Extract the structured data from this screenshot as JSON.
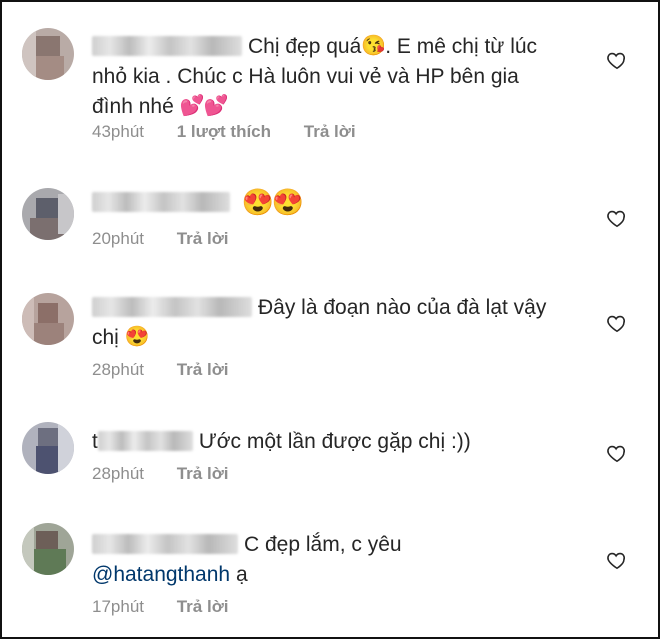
{
  "comments": [
    {
      "initial": "",
      "text_part1": "Chị đẹp quá",
      "emoji1": "kissing-face-emoji",
      "text_part2": ". E mê chị từ lúc nhỏ kia . Chúc c Hà luôn vui vẻ và HP bên gia đình nhé",
      "emoji2": "two-hearts-emoji",
      "time": "43phút",
      "likes": "1 lượt thích",
      "reply": "Trả lời"
    },
    {
      "initial": "",
      "emoji1": "heart-eyes-emoji",
      "time": "20phút",
      "reply": "Trả lời"
    },
    {
      "initial": "",
      "text_part1": "Đây là đoạn nào của đà lạt vậy chị",
      "emoji1": "heart-eyes-emoji",
      "time": "28phút",
      "reply": "Trả lời"
    },
    {
      "initial": "t",
      "text_part1": "Ước một lần được gặp chị :))",
      "time": "28phút",
      "reply": "Trả lời"
    },
    {
      "initial": "",
      "text_part1": "C đẹp lắm, c yêu",
      "mention": "@hatangthanh",
      "text_part2": "ạ",
      "time": "17phút",
      "reply": "Trả lời"
    }
  ],
  "colors": {
    "text": "#262626",
    "meta": "#8e8e8e",
    "mention": "#00376b",
    "emoji_heart": "#ff4fa3",
    "emoji_face": "#ffcc33"
  }
}
